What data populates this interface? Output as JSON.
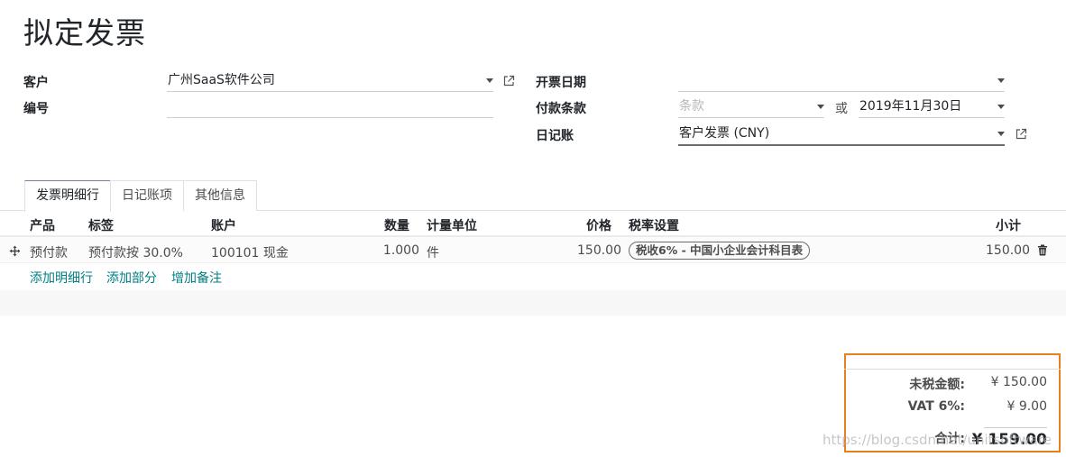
{
  "title": "拟定发票",
  "form": {
    "customer_label": "客户",
    "customer_value": "广州SaaS软件公司",
    "number_label": "编号",
    "number_value": "",
    "invoice_date_label": "开票日期",
    "invoice_date_value": "",
    "payment_terms_label": "付款条款",
    "payment_terms_placeholder": "条款",
    "or_text": "或",
    "due_date_value": "2019年11月30日",
    "journal_label": "日记账",
    "journal_value": "客户发票 (CNY)"
  },
  "tabs": [
    {
      "label": "发票明细行",
      "active": true
    },
    {
      "label": "日记账项",
      "active": false
    },
    {
      "label": "其他信息",
      "active": false
    }
  ],
  "table": {
    "headers": {
      "product": "产品",
      "label": "标签",
      "account": "账户",
      "quantity": "数量",
      "uom": "计量单位",
      "price": "价格",
      "taxes": "税率设置",
      "subtotal": "小计"
    },
    "rows": [
      {
        "product": "预付款",
        "label": "预付款按 30.0%",
        "account": "100101 现金",
        "quantity": "1.000",
        "uom": "件",
        "price": "150.00",
        "tax": "税收6% - 中国小企业会计科目表",
        "subtotal": "150.00"
      }
    ],
    "actions": {
      "add_line": "添加明细行",
      "add_section": "添加部分",
      "add_note": "增加备注"
    }
  },
  "totals": {
    "untaxed_label": "未税金额:",
    "untaxed_value": "¥ 150.00",
    "vat_label": "VAT 6%:",
    "vat_value": "¥ 9.00",
    "total_label": "合计:",
    "total_value": "¥ 159.00"
  },
  "watermark": "https://blog.csdn.net/unitsoftware",
  "colors": {
    "link": "#017e84",
    "highlight_box": "#e67e22",
    "tab_active_accent": "#7c7bad"
  },
  "icons": {
    "external_link": "external-link-icon",
    "drag_handle": "move-arrows-icon",
    "delete": "trash-icon",
    "dropdown": "caret-down-icon"
  }
}
